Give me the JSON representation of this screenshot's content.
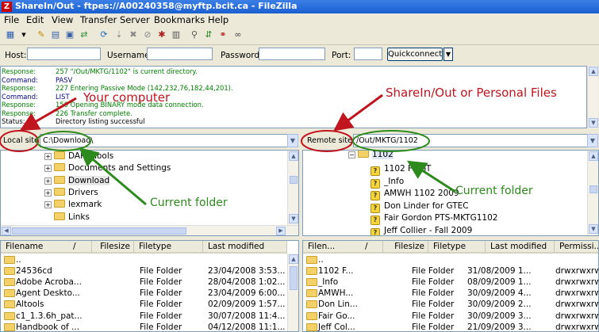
{
  "window": {
    "title": "ShareIn/Out - ftpes://A00240358@myftp.bcit.ca - FileZilla",
    "app_icon": "Z"
  },
  "menu": [
    "File",
    "Edit",
    "View",
    "Transfer",
    "Server",
    "Bookmarks",
    "Help"
  ],
  "quickconnect": {
    "host_label": "Host:",
    "username_label": "Username:",
    "password_label": "Password:",
    "port_label": "Port:",
    "host_value": "",
    "username_value": "",
    "password_value": "",
    "port_value": "",
    "button_label": "Quickconnect"
  },
  "log": [
    {
      "type": "Response:",
      "msg": "257 \"/Out/MKTG/1102\" is current directory.",
      "color": "#008000"
    },
    {
      "type": "Command:",
      "msg": "PASV",
      "color": "#000080"
    },
    {
      "type": "Response:",
      "msg": "227 Entering Passive Mode (142,232,76,182,44,201).",
      "color": "#008000"
    },
    {
      "type": "Command:",
      "msg": "LIST",
      "color": "#000080"
    },
    {
      "type": "Response:",
      "msg": "150 Opening BINARY mode data connection.",
      "color": "#008000"
    },
    {
      "type": "Response:",
      "msg": "226 Transfer complete.",
      "color": "#008000"
    },
    {
      "type": "Status:",
      "msg": "Directory listing successful",
      "color": "#000000"
    }
  ],
  "local": {
    "site_label": "Local site:",
    "path": "C:\\Download\\",
    "tree": [
      "DART Tools",
      "Documents and Settings",
      "Download",
      "Drivers",
      "lexmark",
      "Links"
    ],
    "columns": [
      "Filename",
      "/",
      "Filesize",
      "Filetype",
      "Last modified"
    ],
    "files": [
      {
        "name": "..",
        "size": "",
        "type": "",
        "modified": ""
      },
      {
        "name": "24536cd",
        "size": "",
        "type": "File Folder",
        "modified": "23/04/2008 3:53..."
      },
      {
        "name": "Adobe Acroba...",
        "size": "",
        "type": "File Folder",
        "modified": "28/04/2008 1:02..."
      },
      {
        "name": "Agent Deskto...",
        "size": "",
        "type": "File Folder",
        "modified": "23/04/2009 6:00..."
      },
      {
        "name": "Altools",
        "size": "",
        "type": "File Folder",
        "modified": "02/09/2009 1:57..."
      },
      {
        "name": "c1_1.3.6h_pat...",
        "size": "",
        "type": "File Folder",
        "modified": "30/07/2008 11:4..."
      },
      {
        "name": "Handbook of ...",
        "size": "",
        "type": "File Folder",
        "modified": "04/12/2008 11:1..."
      }
    ]
  },
  "remote": {
    "site_label": "Remote site:",
    "path": "/Out/MKTG/1102",
    "tree_root": "1102",
    "tree": [
      "1102 FMGT",
      "_Info",
      "AMWH 1102 2009",
      "Don Linder for GTEC",
      "Fair Gordon PTS-MKTG1102",
      "Jeff Collier - Fall 2009"
    ],
    "columns": [
      "Filen...",
      "/",
      "Filesize",
      "Filetype",
      "Last modified",
      "Permissi..."
    ],
    "files": [
      {
        "name": "..",
        "size": "",
        "type": "",
        "modified": "",
        "perm": ""
      },
      {
        "name": "1102 F...",
        "size": "",
        "type": "File Folder",
        "modified": "31/08/2009 1...",
        "perm": "drwxrwxrwx"
      },
      {
        "name": "_Info",
        "size": "",
        "type": "File Folder",
        "modified": "08/09/2009 1...",
        "perm": "drwxrwxrwx"
      },
      {
        "name": "AMWH...",
        "size": "",
        "type": "File Folder",
        "modified": "30/09/2009 4...",
        "perm": "drwxrwxrwx"
      },
      {
        "name": "Don Lin...",
        "size": "",
        "type": "File Folder",
        "modified": "30/09/2009 2...",
        "perm": "drwxrwxrwx"
      },
      {
        "name": "Fair Go...",
        "size": "",
        "type": "File Folder",
        "modified": "30/09/2009 3...",
        "perm": "drwxrwxrwx"
      },
      {
        "name": "Jeff Col...",
        "size": "",
        "type": "File Folder",
        "modified": "21/09/2009 3...",
        "perm": "drwxrwxrwx"
      }
    ]
  },
  "annotations": {
    "your_computer": "Your computer",
    "sharein": "ShareIn/Out or Personal Files",
    "current_folder_local": "Current folder",
    "current_folder_remote": "Current folder",
    "red": "#c0141e",
    "green": "#2d8a1c"
  }
}
